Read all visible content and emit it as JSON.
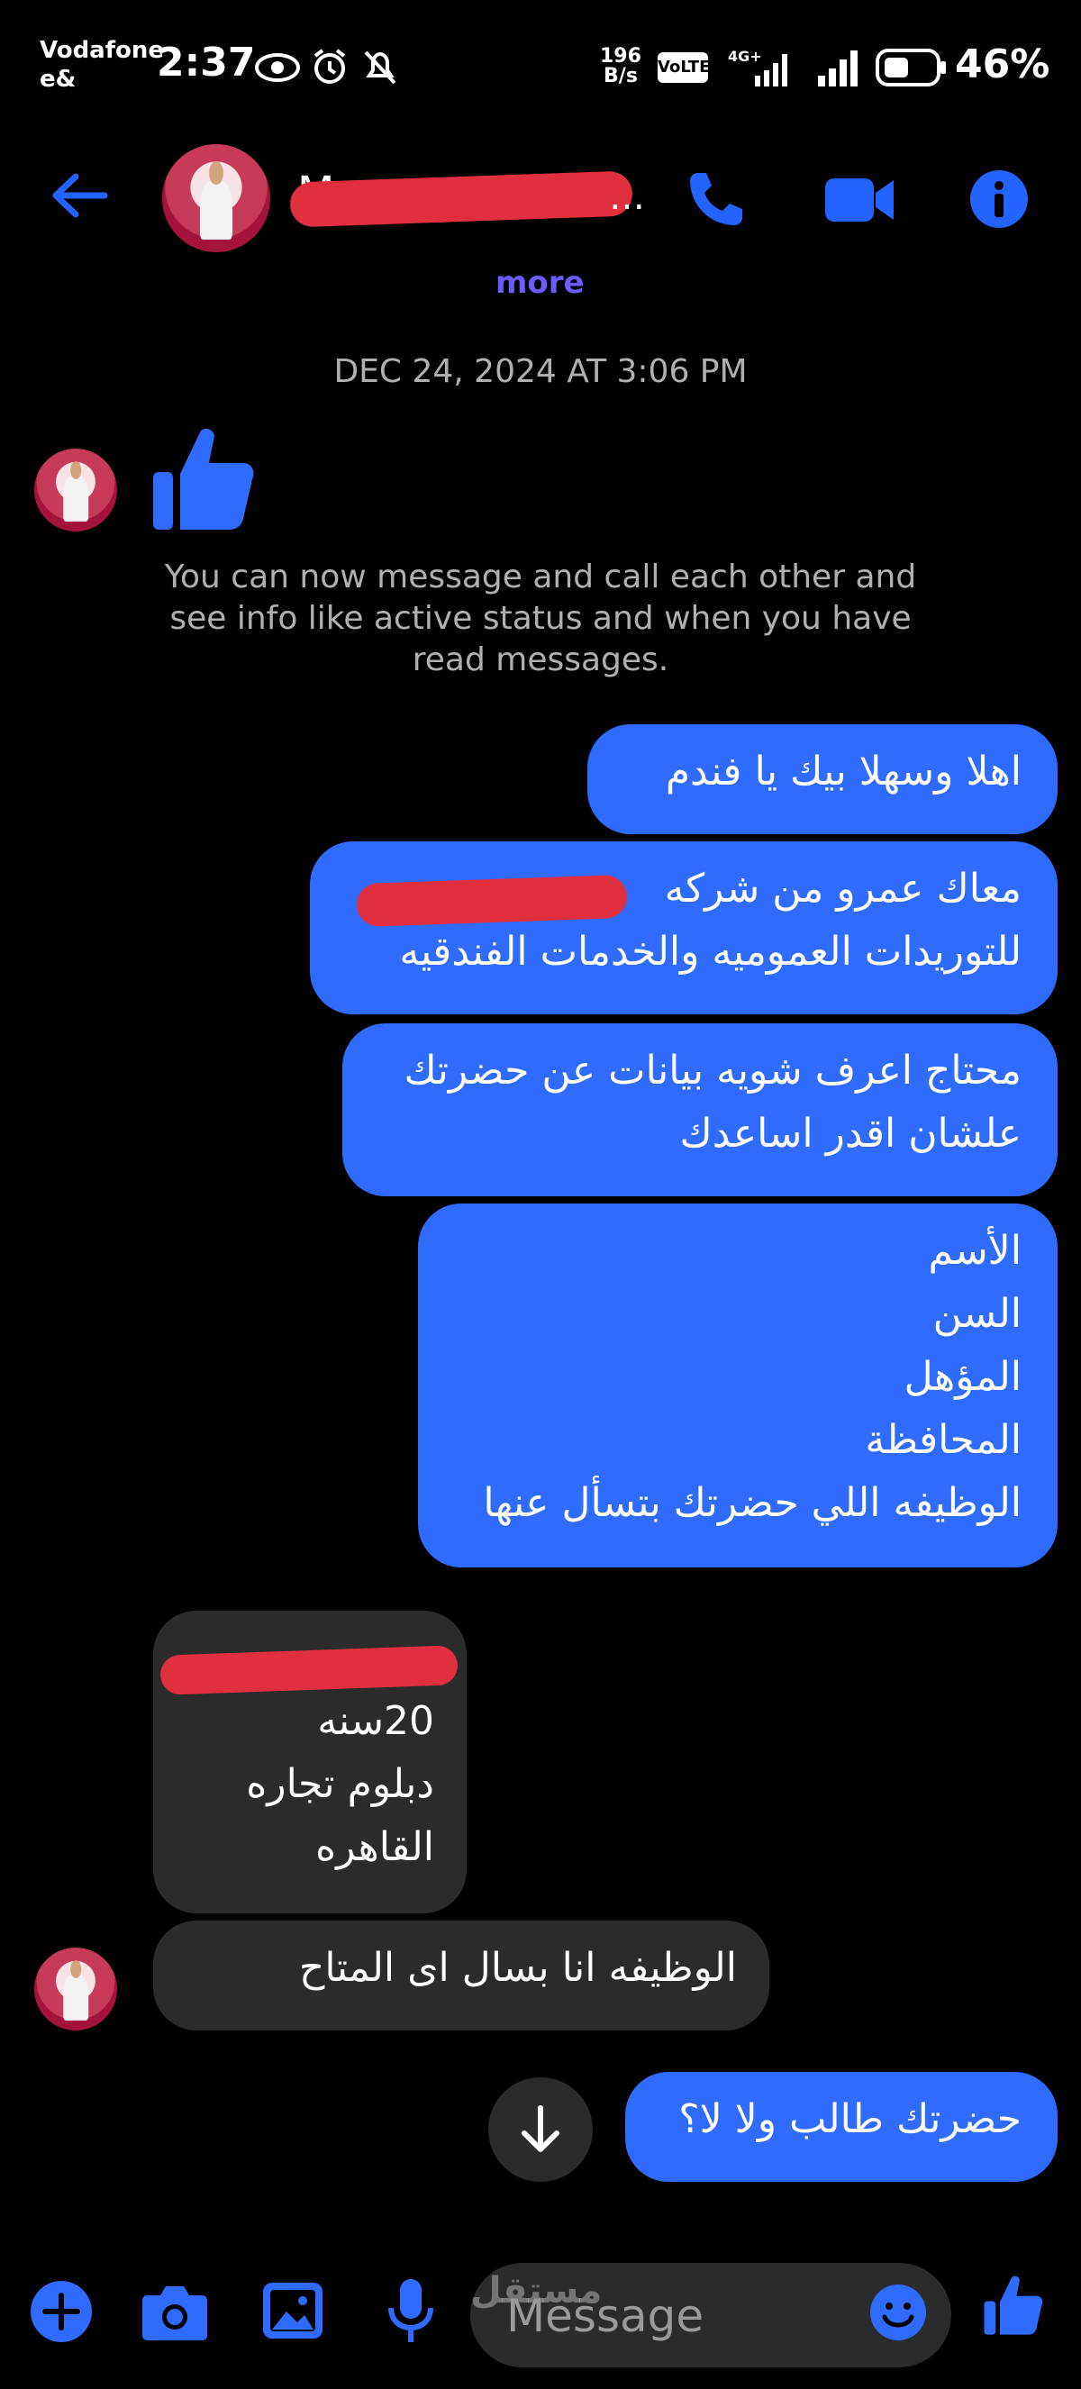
{
  "status_bar": {
    "carrier_line1": "Vodafone",
    "carrier_line2": "e&",
    "time": "2:37",
    "net_speed_value": "196",
    "net_speed_unit": "B/s",
    "volte": "VoLTE",
    "network": "4G+",
    "battery": "46%"
  },
  "header": {
    "contact_name": "M",
    "more_link": "more"
  },
  "conversation": {
    "timestamp": "DEC 24, 2024 AT 3:06 PM",
    "connection_notice": "You can now message and call each other and see info like active status and when you have read messages.",
    "messages": [
      {
        "side": "out",
        "lines": [
          "اهلا وسهلا بيك يا فندم"
        ]
      },
      {
        "side": "out",
        "lines": [
          "معاك عمرو من شركه",
          "للتوريدات العموميه والخدمات الفندقيه"
        ]
      },
      {
        "side": "out",
        "lines": [
          "محتاج اعرف شويه بيانات عن حضرتك",
          "علشان اقدر اساعدك"
        ]
      },
      {
        "side": "out",
        "lines": [
          "الأسم",
          "السن",
          "المؤهل",
          "المحافظة",
          "الوظيفه اللي حضرتك بتسأل عنها"
        ]
      },
      {
        "side": "in",
        "lines": [
          "20سنه",
          "دبلوم تجاره",
          "القاهره"
        ]
      },
      {
        "side": "in",
        "lines": [
          "الوظيفه انا بسال اى المتاح"
        ]
      },
      {
        "side": "out",
        "lines": [
          "حضرتك طالب ولا لا؟"
        ]
      }
    ]
  },
  "composer": {
    "placeholder": "Message",
    "watermark": "مستقل"
  },
  "colors": {
    "accent": "#2f6bff",
    "incoming_bubble": "#2b2b2b",
    "background": "#000000"
  }
}
